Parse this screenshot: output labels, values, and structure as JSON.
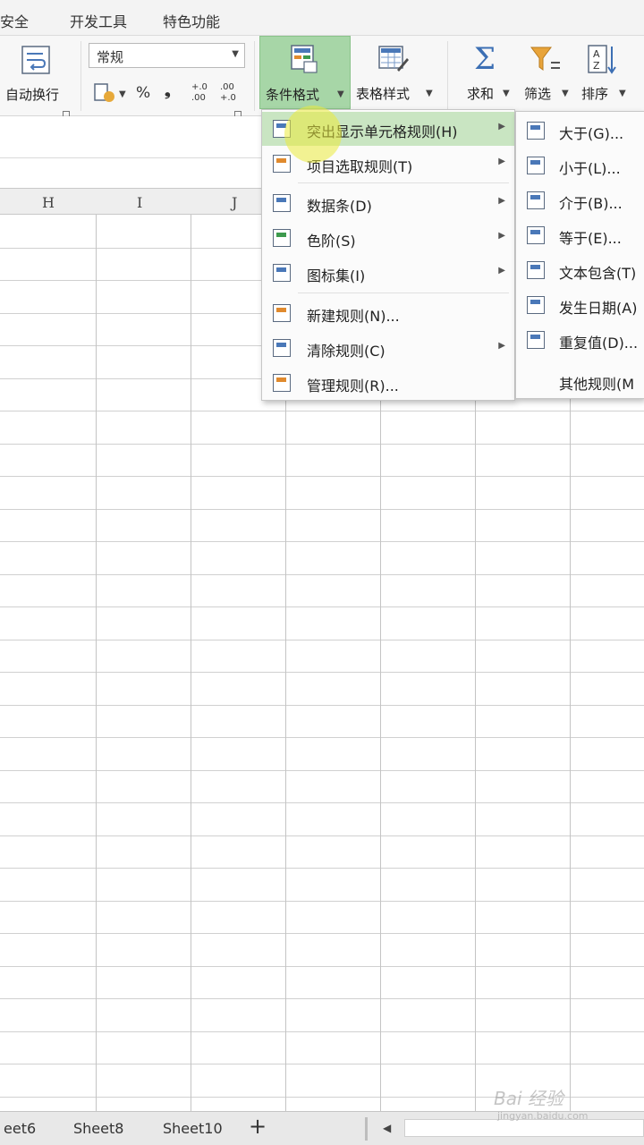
{
  "menubar": {
    "tabs": [
      "安全",
      "开发工具",
      "特色功能"
    ]
  },
  "ribbon": {
    "wrap_label": "自动换行",
    "number_format_value": "常规",
    "percent_symbol": "%",
    "comma_symbol": "❟",
    "inc_decimal": "+.0 .00",
    "dec_decimal": ".00 →.0",
    "conditional_format_label": "条件格式",
    "table_style_label": "表格样式",
    "sum_label": "求和",
    "filter_label": "筛选",
    "sort_label": "排序"
  },
  "columns": [
    "H",
    "I",
    "J"
  ],
  "conditional_menu": {
    "items": [
      {
        "label": "突出显示单元格规则(H)",
        "submenu": true,
        "highlighted": true
      },
      {
        "label": "项目选取规则(T)",
        "submenu": true
      },
      {
        "label": "数据条(D)",
        "submenu": true
      },
      {
        "label": "色阶(S)",
        "submenu": true
      },
      {
        "label": "图标集(I)",
        "submenu": true
      },
      {
        "label": "新建规则(N)...",
        "submenu": false
      },
      {
        "label": "清除规则(C)",
        "submenu": true
      },
      {
        "label": "管理规则(R)...",
        "submenu": false
      }
    ]
  },
  "highlight_submenu": {
    "items": [
      {
        "label": "大于(G)..."
      },
      {
        "label": "小于(L)..."
      },
      {
        "label": "介于(B)..."
      },
      {
        "label": "等于(E)..."
      },
      {
        "label": "文本包含(T)"
      },
      {
        "label": "发生日期(A)"
      },
      {
        "label": "重复值(D)..."
      },
      {
        "label": "其他规则(M"
      }
    ]
  },
  "sheet_tabs": [
    "eet6",
    "Sheet8",
    "Sheet10"
  ],
  "add_sheet_symbol": "+",
  "watermark": {
    "text": "Bai 经验",
    "sub": "jingyan.baidu.com"
  },
  "colors": {
    "highlight": "#c9e5c2",
    "cond_button": "#a7d6a7"
  }
}
